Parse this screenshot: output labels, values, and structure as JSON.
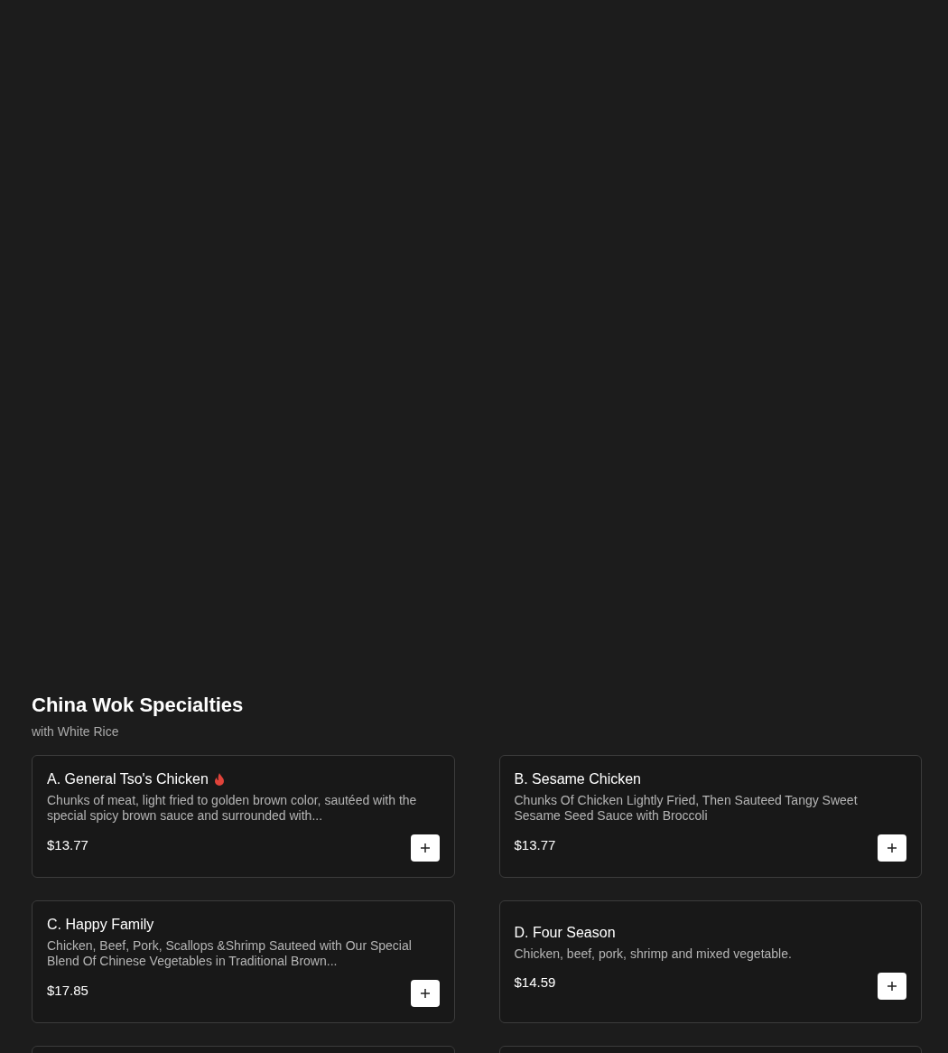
{
  "section": {
    "title": "China Wok Specialties",
    "subtitle": "with White Rice"
  },
  "items": [
    {
      "name": "A. General Tso's Chicken",
      "spicy": true,
      "description": "Chunks of meat, light fried to golden brown color, sautéed with the special spicy brown sauce and surrounded with...",
      "price": "$13.77"
    },
    {
      "name": "B. Sesame Chicken",
      "spicy": false,
      "description": "Chunks Of Chicken Lightly Fried, Then Sauteed Tangy Sweet Sesame Seed Sauce with Broccoli",
      "price": "$13.77"
    },
    {
      "name": "C. Happy Family",
      "spicy": false,
      "description": "Chicken, Beef, Pork, Scallops &Shrimp Sauteed with Our Special Blend Of Chinese Vegetables in Traditional Brown...",
      "price": "$17.85"
    },
    {
      "name": "D. Four Season",
      "spicy": false,
      "description": "Chicken, beef, pork, shrimp and mixed vegetable.",
      "price": "$14.59"
    }
  ]
}
